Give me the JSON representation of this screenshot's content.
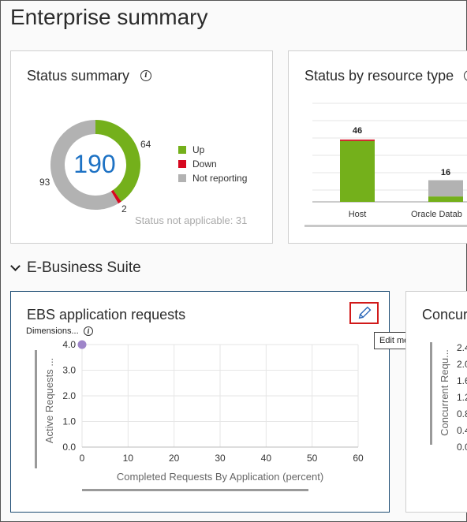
{
  "page": {
    "title": "Enterprise summary"
  },
  "status_summary": {
    "title": "Status summary",
    "total": "190",
    "labels": {
      "up": "64",
      "down": "2",
      "not_reporting": "93"
    },
    "legend": [
      {
        "label": "Up",
        "color": "#74b01b"
      },
      {
        "label": "Down",
        "color": "#d6081f"
      },
      {
        "label": "Not reporting",
        "color": "#b2b2b2"
      }
    ],
    "not_applicable": "Status not applicable: 31"
  },
  "status_by_type": {
    "title": "Status by resource type",
    "bars": [
      {
        "label": "Host",
        "value": "46"
      },
      {
        "label": "Oracle Datab",
        "value": "16"
      }
    ]
  },
  "section": {
    "title": "E-Business Suite"
  },
  "ebs_requests": {
    "title": "EBS application requests",
    "dimensions_label": "Dimensions...",
    "tooltip": "Edit metrics",
    "x_label": "Completed Requests By Application (percent)",
    "y_label": "Active Requests ...",
    "x_ticks": [
      "0",
      "10",
      "20",
      "30",
      "40",
      "50",
      "60"
    ],
    "y_ticks": [
      "0.0",
      "1.0",
      "2.0",
      "3.0",
      "4.0"
    ]
  },
  "concurrent": {
    "title": "Concur",
    "y_label": "Concurrent Requ...",
    "y_ticks": [
      "2.4",
      "2.0",
      "1.6",
      "1.2",
      "0.8",
      "0.4",
      "0.0"
    ]
  },
  "chart_data": [
    {
      "type": "pie",
      "title": "Status summary",
      "categories": [
        "Up",
        "Down",
        "Not reporting"
      ],
      "values": [
        64,
        2,
        93
      ],
      "center_label": "190",
      "colors": [
        "#74b01b",
        "#d6081f",
        "#b2b2b2"
      ]
    },
    {
      "type": "bar",
      "title": "Status by resource type",
      "categories": [
        "Host",
        "Oracle Datab"
      ],
      "series": [
        {
          "values": [
            45,
            4
          ],
          "color": "#74b01b"
        },
        {
          "values": [
            1,
            0
          ],
          "color": "#d6081f"
        },
        {
          "values": [
            0,
            12
          ],
          "color": "#b2b2b2"
        }
      ],
      "totals": [
        46,
        16
      ]
    },
    {
      "type": "scatter",
      "title": "EBS application requests",
      "xlabel": "Completed Requests By Application (percent)",
      "ylabel": "Active Requests ...",
      "xlim": [
        0,
        60
      ],
      "ylim": [
        0,
        4.0
      ],
      "points": [
        {
          "x": 0,
          "y": 4.0
        }
      ],
      "color": "#9e85c9"
    }
  ]
}
